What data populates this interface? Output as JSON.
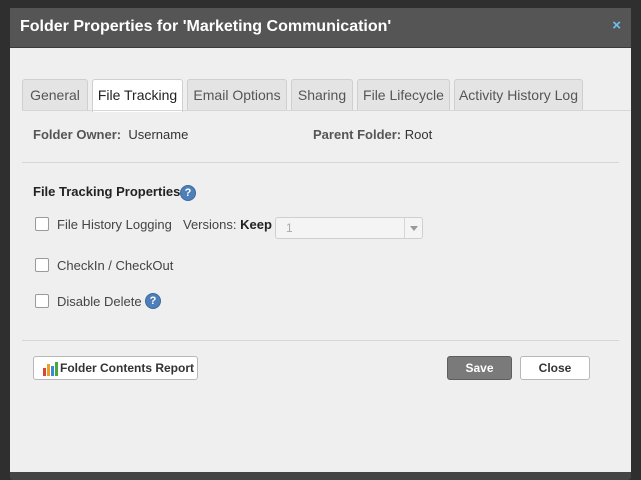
{
  "dialog": {
    "title": "Folder Properties for 'Marketing Communication'",
    "close_glyph": "×"
  },
  "tabs": [
    {
      "label": "General",
      "active": false
    },
    {
      "label": "File Tracking",
      "active": true
    },
    {
      "label": "Email Options",
      "active": false
    },
    {
      "label": "Sharing",
      "active": false
    },
    {
      "label": "File Lifecycle",
      "active": false
    },
    {
      "label": "Activity History Log",
      "active": false
    }
  ],
  "info": {
    "owner_label": "Folder Owner:",
    "owner_value": "Username",
    "parent_label": "Parent Folder:",
    "parent_value": "Root"
  },
  "tracking": {
    "section_title": "File Tracking Properties:",
    "help_glyph": "?",
    "file_history_label": "File History Logging",
    "versions_label": "Versions:",
    "versions_keep": "Keep",
    "versions_value": "1",
    "checkin_label": "CheckIn / CheckOut",
    "disable_delete_label": "Disable Delete",
    "file_history_checked": false,
    "checkin_checked": false,
    "disable_delete_checked": false
  },
  "footer": {
    "report_label": "Folder Contents Report",
    "save_label": "Save",
    "close_label": "Close"
  },
  "colors": {
    "accent": "#4f7fb8",
    "close_icon": "#6fc0e8",
    "save_button": "#7a7a7a"
  },
  "icons": {
    "close": "close-icon",
    "help": "help-icon",
    "report": "bar-chart-icon",
    "dropdown": "chevron-down-icon"
  }
}
